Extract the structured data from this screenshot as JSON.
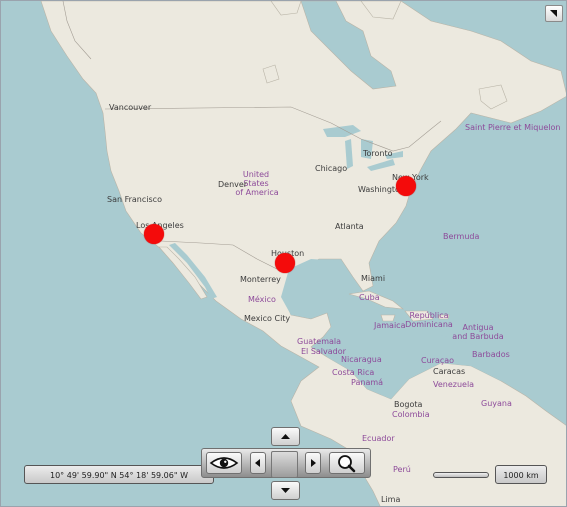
{
  "coordinates_readout": "10° 49' 59.90\" N 54° 18' 59.06\" W",
  "scale": {
    "label": "1000 km"
  },
  "colors": {
    "water": "#a9cbd0",
    "land": "#ece9df",
    "marker": "#f40b0b",
    "country_label": "#8d4a9a"
  },
  "icons": {
    "corner": "expand-arrow-icon",
    "view": "eye-icon",
    "zoom": "magnifier-icon"
  },
  "markers": [
    {
      "name": "Los Angeles"
    },
    {
      "name": "Houston"
    },
    {
      "name": "New York"
    }
  ],
  "labels": {
    "vancouver": "Vancouver",
    "san_francisco": "San Francisco",
    "los_angeles": "Los Angeles",
    "united_states_1": "United",
    "united_states_2": "States",
    "united_states_3": "of America",
    "denver": "Denver",
    "chicago": "Chicago",
    "toronto": "Toronto",
    "new_york": "New York",
    "washington": "Washington",
    "saint_pierre": "Saint Pierre et Miquelon",
    "atlanta": "Atlanta",
    "bermuda": "Bermuda",
    "houston": "Houston",
    "monterrey": "Monterrey",
    "mexico": "México",
    "mexico_city": "Mexico City",
    "miami": "Miami",
    "cuba": "Cuba",
    "jamaica": "Jamaica",
    "dominican_1": "República",
    "dominican_2": "Dominicana",
    "antigua_1": "Antigua",
    "antigua_2": "and Barbuda",
    "guatemala": "Guatemala",
    "el_salvador": "El Salvador",
    "nicaragua": "Nicaragua",
    "costa_rica": "Costa Rica",
    "panama": "Panamá",
    "curacao": "Curaçao",
    "caracas": "Caracas",
    "barbados": "Barbados",
    "venezuela": "Venezuela",
    "bogota": "Bogota",
    "colombia": "Colombia",
    "guyana": "Guyana",
    "ecuador": "Ecuador",
    "peru": "Perú",
    "lima": "Lima"
  }
}
